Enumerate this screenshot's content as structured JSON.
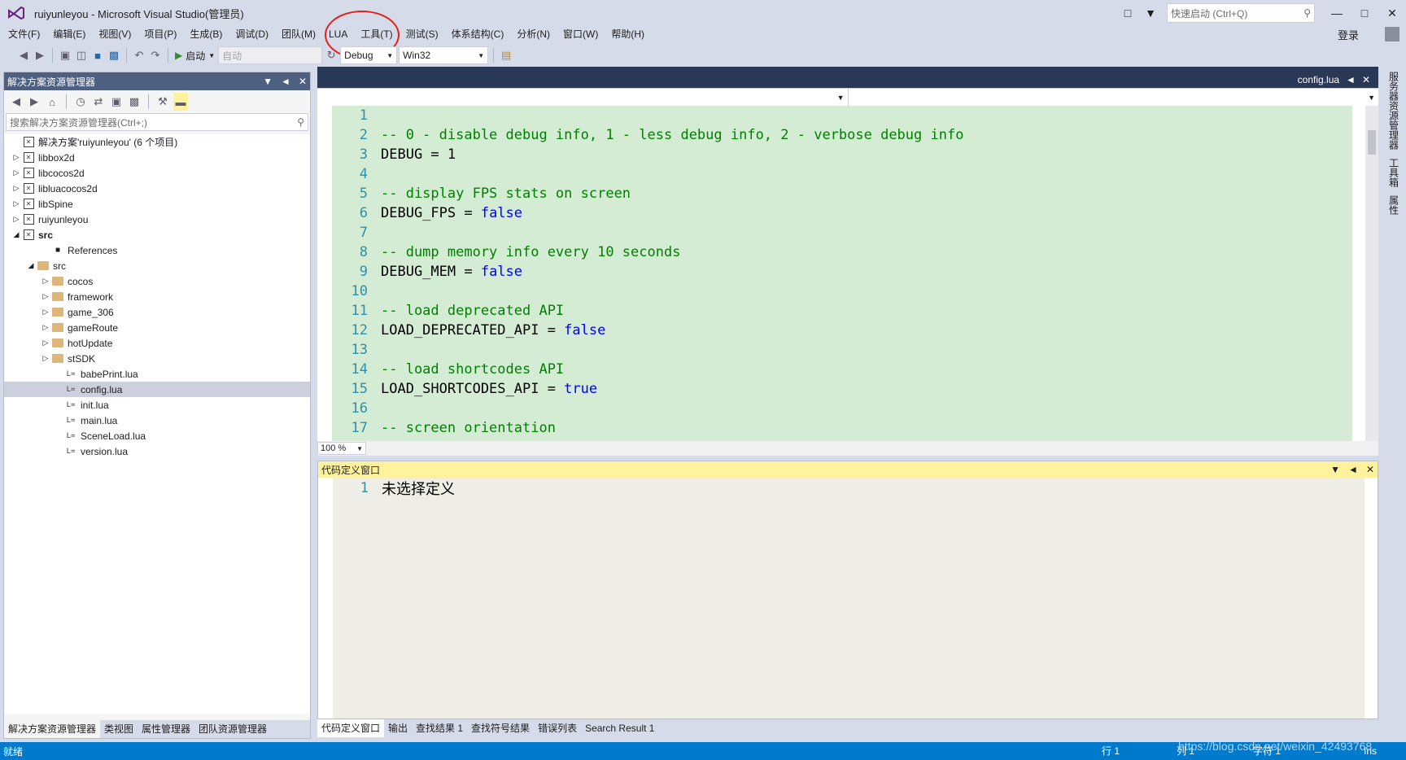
{
  "window": {
    "title": "ruiyunleyou - Microsoft Visual Studio(管理员)",
    "quick_launch_placeholder": "快速启动 (Ctrl+Q)",
    "login": "登录"
  },
  "menu": [
    "文件(F)",
    "编辑(E)",
    "视图(V)",
    "项目(P)",
    "生成(B)",
    "调试(D)",
    "团队(M)",
    "LUA",
    "工具(T)",
    "测试(S)",
    "体系结构(C)",
    "分析(N)",
    "窗口(W)",
    "帮助(H)"
  ],
  "toolbar": {
    "start_label": "启动",
    "auto_combo": "自动",
    "config_combo": "Debug",
    "platform_combo": "Win32"
  },
  "solution_explorer": {
    "title": "解决方案资源管理器",
    "search_placeholder": "搜索解决方案资源管理器(Ctrl+;)",
    "items": [
      {
        "label": "解决方案'ruiyunleyou' (6 个项目)",
        "arrow": "",
        "icon": "solution"
      },
      {
        "label": "libbox2d",
        "arrow": "▷",
        "icon": "project"
      },
      {
        "label": "libcocos2d",
        "arrow": "▷",
        "icon": "project"
      },
      {
        "label": "libluacocos2d",
        "arrow": "▷",
        "icon": "project"
      },
      {
        "label": "libSpine",
        "arrow": "▷",
        "icon": "project"
      },
      {
        "label": "ruiyunleyou",
        "arrow": "▷",
        "icon": "project"
      },
      {
        "label": "src",
        "arrow": "◢",
        "icon": "project"
      },
      {
        "label": "References",
        "arrow": "",
        "icon": "references"
      },
      {
        "label": "src",
        "arrow": "◢",
        "icon": "folder-open"
      },
      {
        "label": "cocos",
        "arrow": "▷",
        "icon": "folder"
      },
      {
        "label": "framework",
        "arrow": "▷",
        "icon": "folder"
      },
      {
        "label": "game_306",
        "arrow": "▷",
        "icon": "folder"
      },
      {
        "label": "gameRoute",
        "arrow": "▷",
        "icon": "folder"
      },
      {
        "label": "hotUpdate",
        "arrow": "▷",
        "icon": "folder"
      },
      {
        "label": "stSDK",
        "arrow": "▷",
        "icon": "folder"
      },
      {
        "label": "babePrint.lua",
        "arrow": "",
        "icon": "lua"
      },
      {
        "label": "config.lua",
        "arrow": "",
        "icon": "lua"
      },
      {
        "label": "init.lua",
        "arrow": "",
        "icon": "lua"
      },
      {
        "label": "main.lua",
        "arrow": "",
        "icon": "lua"
      },
      {
        "label": "SceneLoad.lua",
        "arrow": "",
        "icon": "lua"
      },
      {
        "label": "version.lua",
        "arrow": "",
        "icon": "lua"
      }
    ],
    "tabs": [
      "解决方案资源管理器",
      "类视图",
      "属性管理器",
      "团队资源管理器"
    ]
  },
  "editor": {
    "tab_label": "config.lua",
    "zoom": "100 %",
    "lines": [
      {
        "n": "1",
        "code": ""
      },
      {
        "n": "2",
        "code": "-- 0 - disable debug info, 1 - less debug info, 2 - verbose debug info"
      },
      {
        "n": "3",
        "code": "DEBUG = 1"
      },
      {
        "n": "4",
        "code": ""
      },
      {
        "n": "5",
        "code": "-- display FPS stats on screen"
      },
      {
        "n": "6",
        "code": "DEBUG_FPS = false"
      },
      {
        "n": "7",
        "code": ""
      },
      {
        "n": "8",
        "code": "-- dump memory info every 10 seconds"
      },
      {
        "n": "9",
        "code": "DEBUG_MEM = false"
      },
      {
        "n": "10",
        "code": ""
      },
      {
        "n": "11",
        "code": "-- load deprecated API"
      },
      {
        "n": "12",
        "code": "LOAD_DEPRECATED_API = false"
      },
      {
        "n": "13",
        "code": ""
      },
      {
        "n": "14",
        "code": "-- load shortcodes API"
      },
      {
        "n": "15",
        "code": "LOAD_SHORTCODES_API = true"
      },
      {
        "n": "16",
        "code": ""
      },
      {
        "n": "17",
        "code": "-- screen orientation"
      }
    ]
  },
  "definition_window": {
    "title": "代码定义窗口",
    "line_number": "1",
    "text": "未选择定义"
  },
  "bottom_tabs": [
    "代码定义窗口",
    "输出",
    "查找结果 1",
    "查找符号结果",
    "错误列表",
    "Search Result 1"
  ],
  "right_rail": [
    "服务器资源管理器",
    "工具箱",
    "属性"
  ],
  "status": {
    "ready": "就绪",
    "row": "行 1",
    "col": "列 1",
    "char": "字符 1",
    "ins": "Ins",
    "watermark": "https://blog.csdn.net/weixin_42493768"
  },
  "colors": {
    "accent": "#007acc",
    "panel_header": "#4d6082",
    "code_bg": "#d4ecd4",
    "comment": "#008000",
    "keyword": "#0000ff",
    "annotation": "#e02020"
  }
}
